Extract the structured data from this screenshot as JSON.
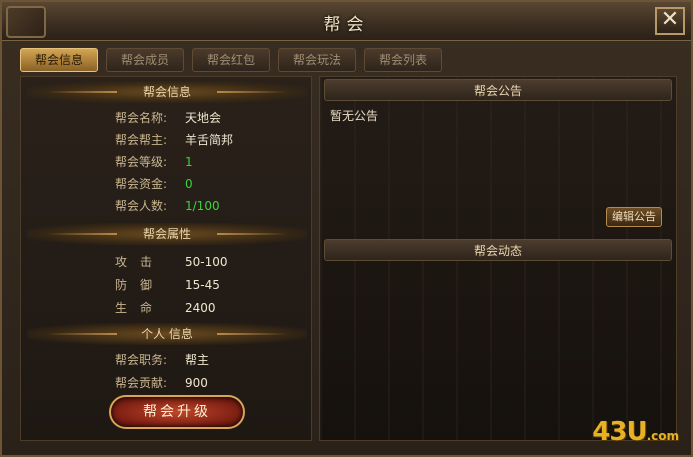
{
  "window": {
    "title": "帮会",
    "close_label": "✕"
  },
  "tabs": [
    {
      "label": "帮会信息",
      "active": true
    },
    {
      "label": "帮会成员",
      "active": false
    },
    {
      "label": "帮会红包",
      "active": false
    },
    {
      "label": "帮会玩法",
      "active": false
    },
    {
      "label": "帮会列表",
      "active": false
    }
  ],
  "guild_info": {
    "header": "帮会信息",
    "name_label": "帮会名称:",
    "name": "天地会",
    "leader_label": "帮会帮主:",
    "leader": "羊舌简邦",
    "level_label": "帮会等级:",
    "level": "1",
    "funds_label": "帮会资金:",
    "funds": "0",
    "members_label": "帮会人数:",
    "members": "1/100"
  },
  "guild_attrs": {
    "header": "帮会属性",
    "attack_label": "攻击",
    "attack": "50-100",
    "defense_label": "防御",
    "defense": "15-45",
    "hp_label": "生命",
    "hp": "2400"
  },
  "personal_info": {
    "header": "个人 信息",
    "position_label": "帮会职务:",
    "position": "帮主",
    "contribution_label": "帮会贡献:",
    "contribution": "900"
  },
  "upgrade_button": "帮会升级",
  "notice": {
    "header": "帮会公告",
    "text": "暂无公告",
    "edit_button": "编辑公告"
  },
  "activity": {
    "header": "帮会动态"
  },
  "watermark": {
    "main": "43U",
    "suffix": ".com"
  },
  "colors": {
    "accent": "#d3a653",
    "green_value": "#3ad43a",
    "upgrade": "#c0462a"
  }
}
